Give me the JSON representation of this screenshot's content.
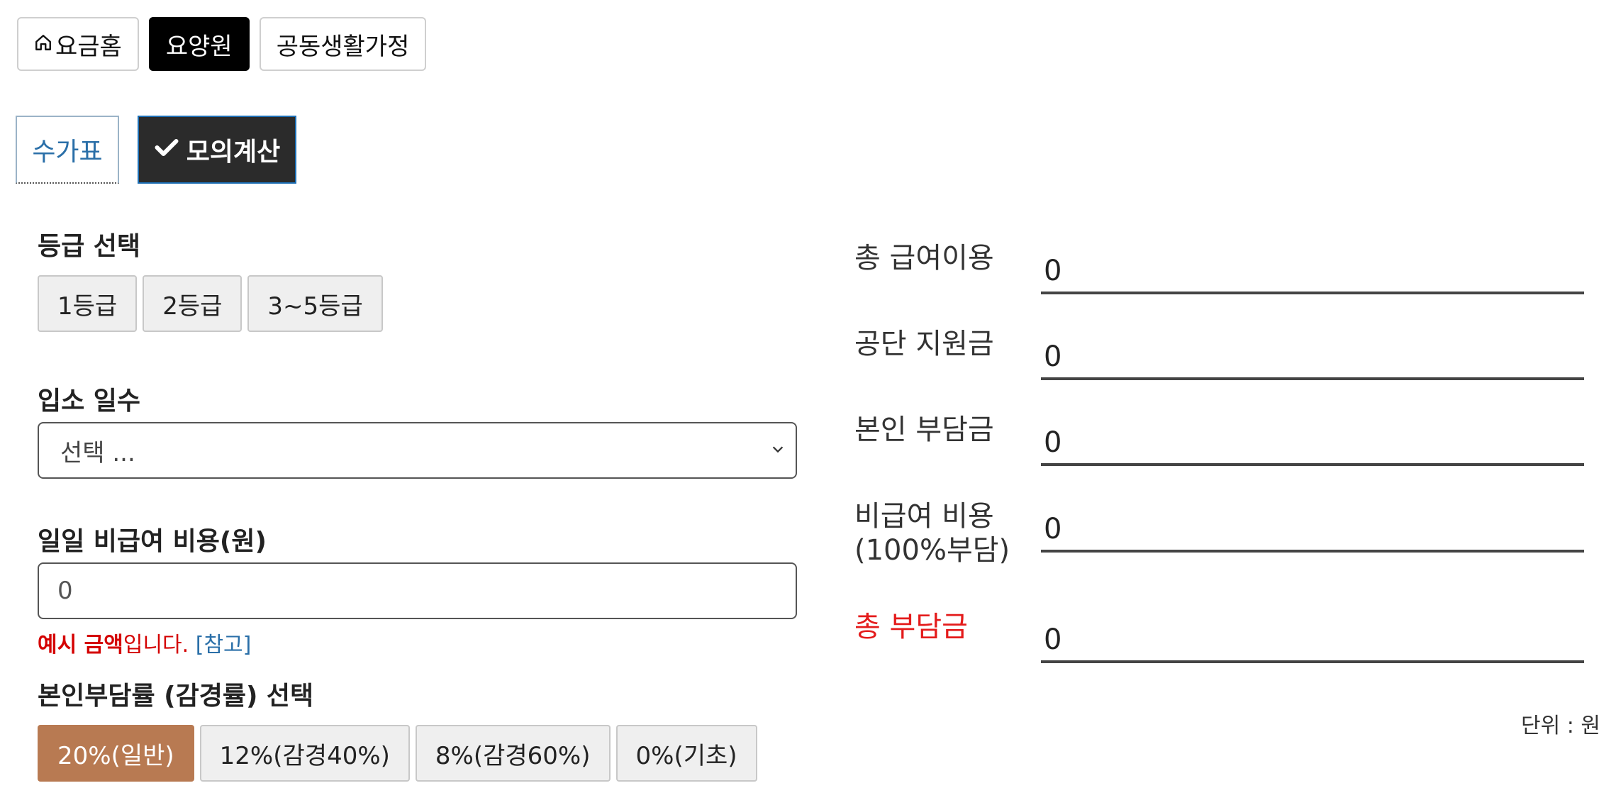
{
  "topnav": {
    "home_icon": "home-icon",
    "items": [
      "요금홈",
      "요양원",
      "공동생활가정"
    ],
    "active_index": 1
  },
  "subtabs": {
    "tab1": "수가표",
    "tab2": "모의계산",
    "check_icon": "check-icon"
  },
  "grade": {
    "label": "등급 선택",
    "options": [
      "1등급",
      "2등급",
      "3~5등급"
    ]
  },
  "days": {
    "label": "입소 일수",
    "selected": "선택 ..."
  },
  "noncovered": {
    "label": "일일 비급여 비용(원)",
    "value": "0",
    "note_bold": "예시 금액",
    "note_rest": "입니다. ",
    "note_ref": "[참고]"
  },
  "rate": {
    "label": "본인부담률 (감경률) 선택",
    "options": [
      "20%(일반)",
      "12%(감경40%)",
      "8%(감경60%)",
      "0%(기초)"
    ],
    "active_index": 0,
    "active_color": "#b87a52"
  },
  "results": {
    "total_benefit_label": "총 급여이용",
    "total_benefit_value": "0",
    "gov_support_label": "공단 지원금",
    "gov_support_value": "0",
    "self_pay_label": "본인 부담금",
    "self_pay_value": "0",
    "noncovered_label_line1": "비급여 비용",
    "noncovered_label_line2": "(100%부담)",
    "noncovered_value": "0",
    "total_pay_label": "총 부담금",
    "total_pay_value": "0",
    "total_pay_color": "#e41b1b",
    "unit": "단위 : 원"
  }
}
